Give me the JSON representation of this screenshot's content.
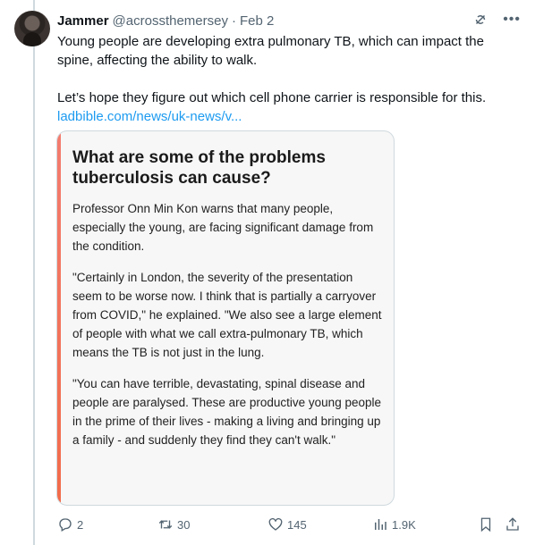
{
  "author": {
    "name": "Jammer",
    "handle": "@acrossthemersey",
    "separator": "·",
    "date": "Feb 2"
  },
  "icons": {
    "grok": "grok-icon",
    "more": "more-icon"
  },
  "tweet": {
    "line1": "Young people are developing extra pulmonary TB, which can impact the spine, affecting the ability to walk.",
    "line2": "Let’s hope they figure out which cell phone carrier is responsible for this.",
    "link": "ladbible.com/news/uk-news/v..."
  },
  "card": {
    "title": "What are some of the problems tuberculosis can cause?",
    "paragraphs": [
      "Professor Onn Min Kon warns that many people, especially the young, are facing significant damage from the condition.",
      "\"Certainly in London, the severity of the presentation seem to be worse now. I think that is partially a carryover from COVID,\" he explained. \"We also see a large element of people with what we call extra-pulmonary TB, which means the TB is not just in the lung.",
      "\"You can have terrible, devastating, spinal disease and people are paralysed. These are productive young people in the prime of their lives - making a living and bringing up a family - and suddenly they find they can't walk.\""
    ],
    "accent_color": "#f26b4a"
  },
  "actions": {
    "replies": "2",
    "retweets": "30",
    "likes": "145",
    "views": "1.9K"
  },
  "colors": {
    "link": "#1d9bf0",
    "secondary_text": "#536471"
  }
}
